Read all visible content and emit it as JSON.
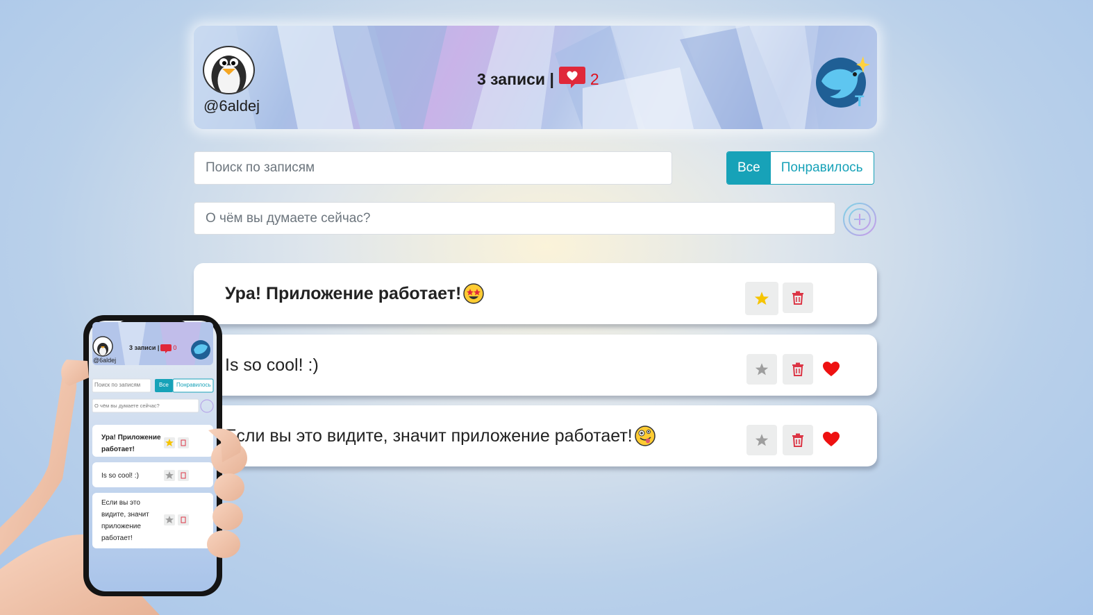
{
  "header": {
    "username": "@6aldej",
    "posts_label": "3 записи |",
    "liked_count": "2"
  },
  "search": {
    "placeholder": "Поиск по записям",
    "filters": [
      {
        "label": "Все",
        "active": true
      },
      {
        "label": "Понравилось",
        "active": false
      }
    ]
  },
  "add": {
    "placeholder": "О чём вы думаете сейчас?"
  },
  "posts": [
    {
      "text": "Ура! Приложение работает!",
      "emoji": "star-struck-emoji",
      "important": true,
      "liked": false
    },
    {
      "text": "Is so cool! :)",
      "emoji": "",
      "important": false,
      "liked": true
    },
    {
      "text": "Если вы это видите, значит приложение работает!",
      "emoji": "zany-face-emoji",
      "important": false,
      "liked": true
    }
  ],
  "phone": {
    "header": {
      "username": "@6aldej",
      "posts_label": "3 записи |",
      "liked_count": "0"
    },
    "search_placeholder": "Поиск по записям",
    "filters": [
      "Все",
      "Понравилось"
    ],
    "add_placeholder": "О чём вы думаете сейчас?",
    "posts": [
      {
        "lines": [
          "Ура! Приложение",
          "работает!"
        ]
      },
      {
        "lines": [
          "Is so cool! :)"
        ]
      },
      {
        "lines": [
          "Если вы это",
          "видите, значит",
          "приложение",
          "работает!"
        ]
      }
    ]
  },
  "colors": {
    "accent": "#17a2b8",
    "like": "#e0101c",
    "star_active": "#f6c400",
    "star_inactive": "#9e9e9e",
    "trash": "#dc3545"
  },
  "icons": [
    "penguin-avatar",
    "heart-bubble-icon",
    "bird-logo",
    "plus-circle-icon",
    "star-icon",
    "trash-icon",
    "heart-icon"
  ]
}
